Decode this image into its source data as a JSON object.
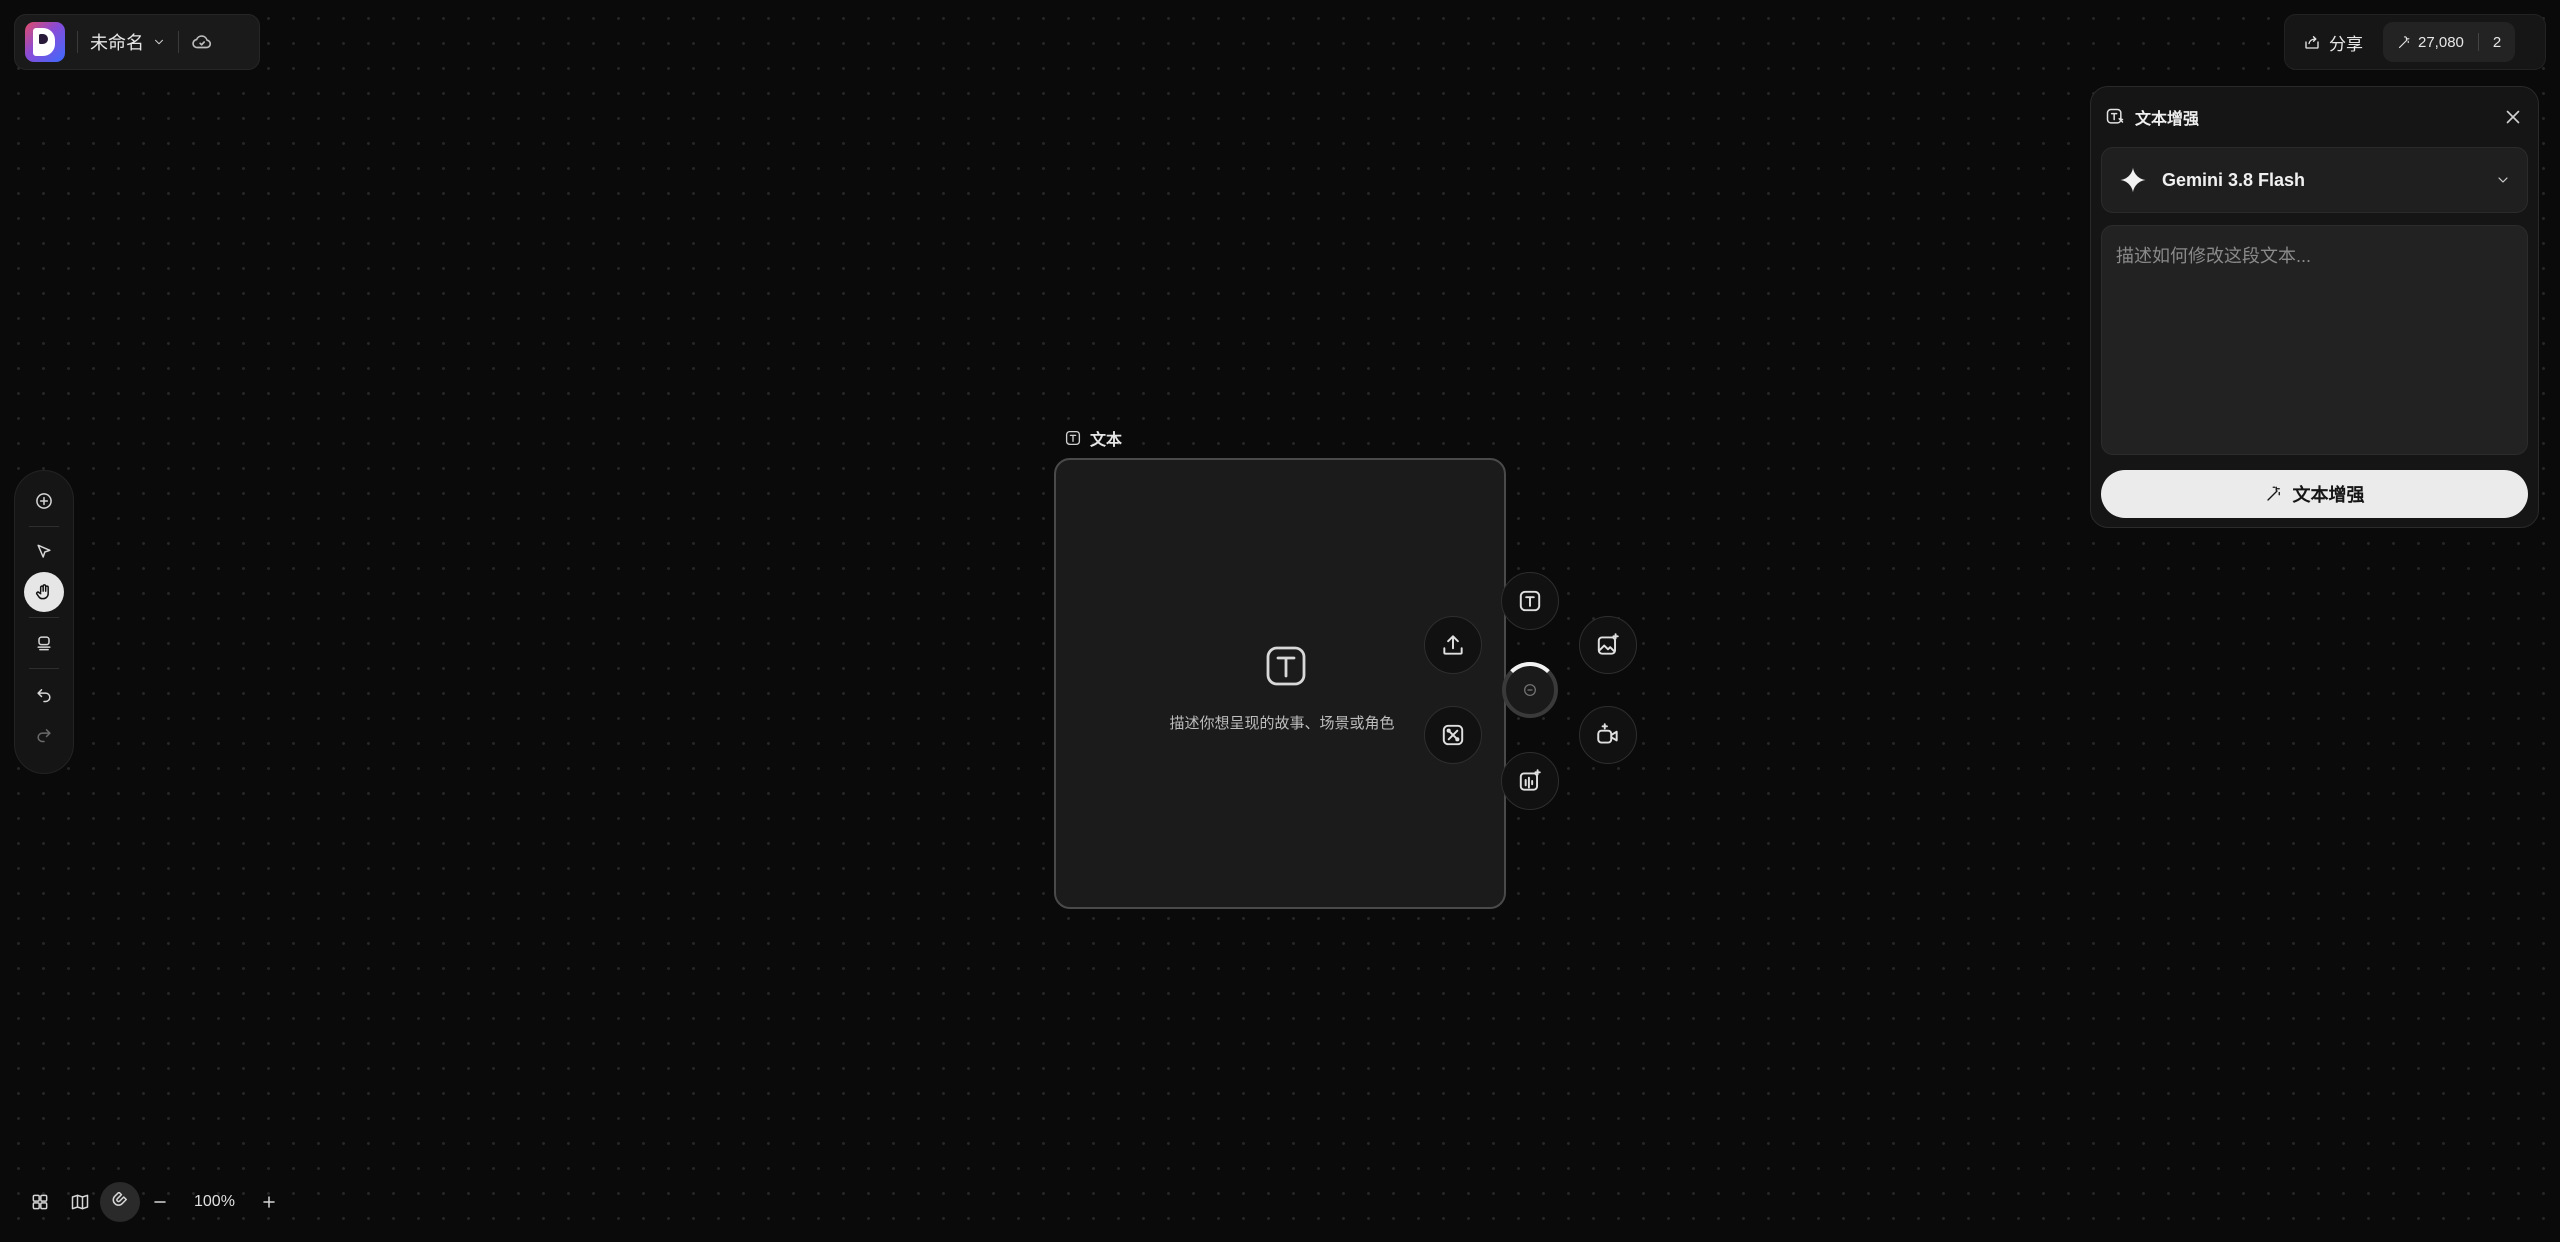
{
  "app": {
    "file_title": "未命名",
    "logo": "picsart-logo",
    "cloud_icon": "cloud-sync-icon"
  },
  "top_right": {
    "share_label": "分享",
    "credits": "27,080",
    "count": "2"
  },
  "panel": {
    "title": "文本增强",
    "model_name": "Gemini 3.8 Flash",
    "prompt_placeholder": "描述如何修改这段文本...",
    "prompt_value": "",
    "submit_label": "文本增强"
  },
  "left_toolbar": {
    "tools": [
      "add-icon",
      "select-pointer-icon",
      "hand-pan-icon",
      "stamp-icon",
      "undo-icon",
      "redo-icon"
    ],
    "active_tool": "hand-pan-icon"
  },
  "bottom_bar": {
    "zoom_level": "100%"
  },
  "node": {
    "label": "文本",
    "hint": "描述你想呈现的故事、场景或角色"
  },
  "node_actions": [
    "upload-icon",
    "shuffle-icon",
    "text-node-icon",
    "image-generate-icon",
    "video-generate-icon",
    "audio-generate-icon"
  ],
  "colors": {
    "background": "#0a0a0a",
    "panel": "#151515",
    "accent_button": "#ebebeb"
  }
}
